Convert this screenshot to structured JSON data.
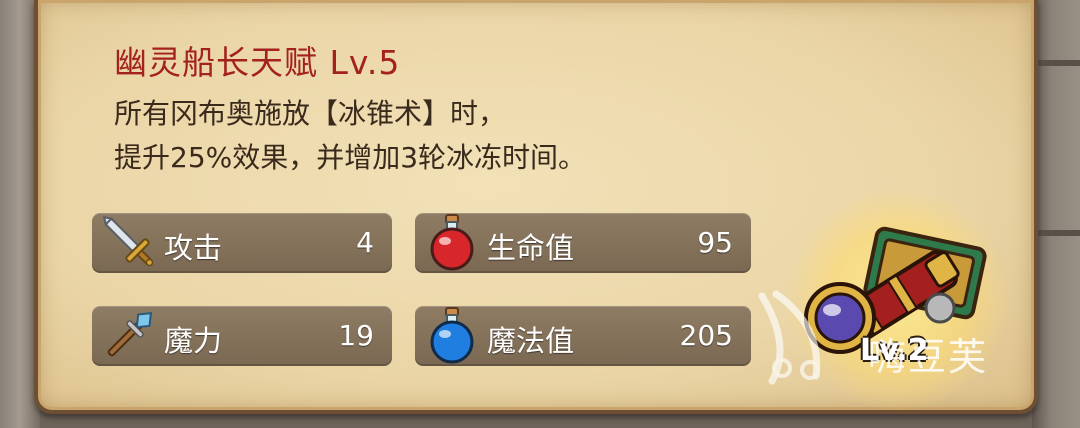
{
  "talent": {
    "title": "幽灵船长天赋 Lv.5",
    "description_lines": [
      "所有冈布奥施放【冰锥术】时，",
      "提升25%效果，并增加3轮冰冻时间。"
    ]
  },
  "stats": [
    {
      "icon": "sword-icon",
      "label": "攻击",
      "value": "4"
    },
    {
      "icon": "red-potion-icon",
      "label": "生命值",
      "value": "95"
    },
    {
      "icon": "magic-staff-icon",
      "label": "魔力",
      "value": "19"
    },
    {
      "icon": "blue-potion-icon",
      "label": "魔法值",
      "value": "205"
    }
  ],
  "relic": {
    "icon": "spyglass-relic-icon",
    "level_label": "Lv.2"
  },
  "watermark": {
    "text": "嗨豆芙",
    "icon": "watermark-logo-icon"
  },
  "colors": {
    "title": "#a3211e",
    "text": "#3a2a1c",
    "parchment": "#ead5a6",
    "stat_bar": "#7a6852"
  }
}
